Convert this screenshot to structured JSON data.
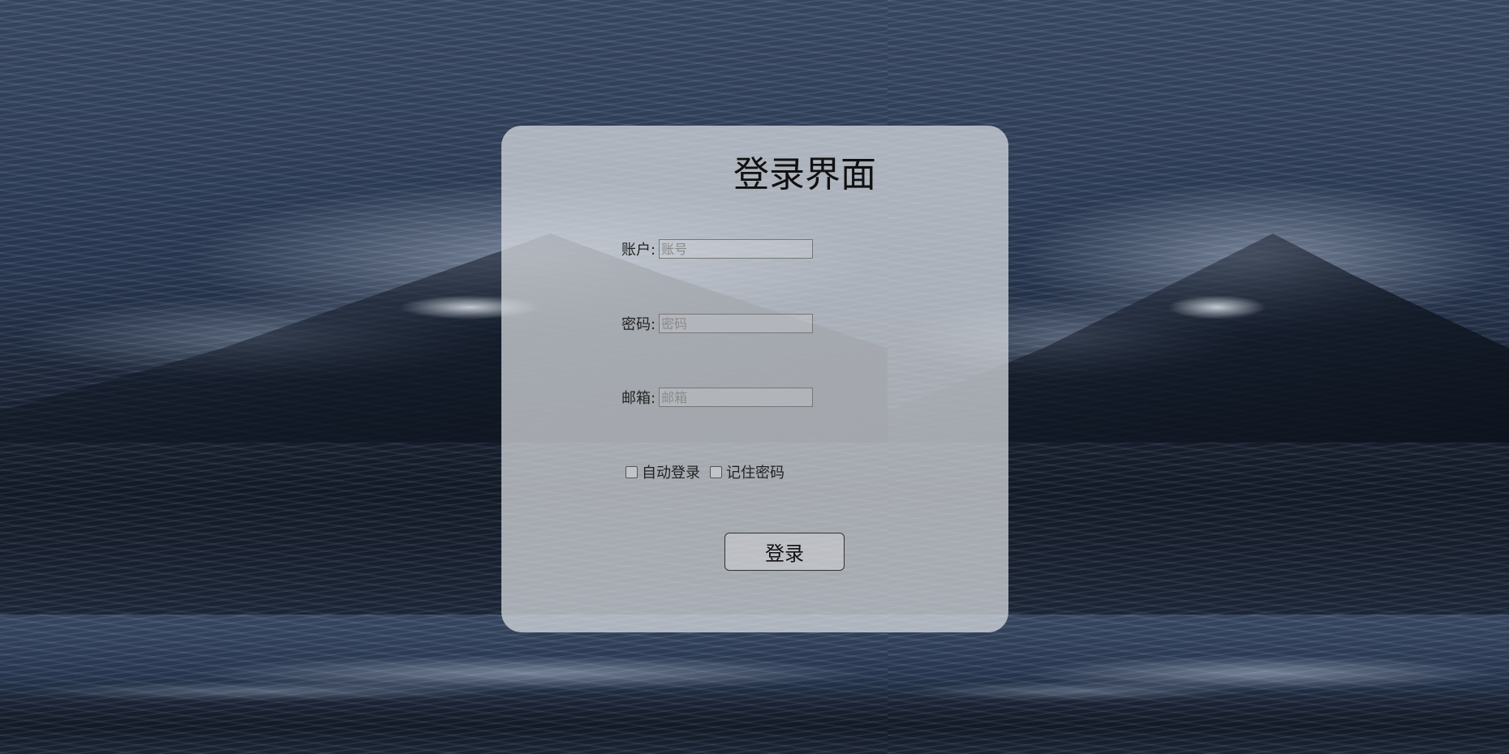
{
  "login": {
    "title": "登录界面",
    "account_label": "账户:",
    "account_placeholder": "账号",
    "password_label": "密码:",
    "password_placeholder": "密码",
    "email_label": "邮箱:",
    "email_placeholder": "邮箱",
    "auto_login_label": "自动登录",
    "remember_label": "记住密码",
    "submit_label": "登录"
  },
  "background": {
    "description_icon": "ocean-waves-image"
  }
}
